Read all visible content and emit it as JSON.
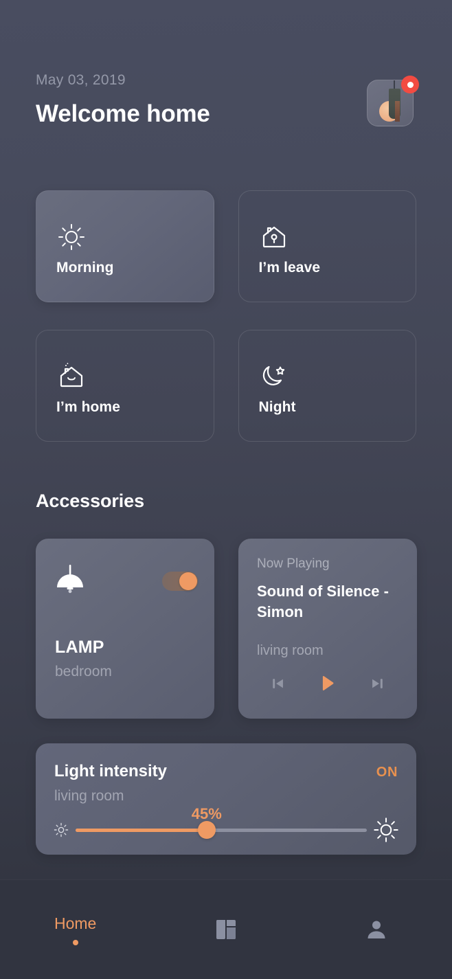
{
  "header": {
    "date": "May 03, 2019",
    "title": "Welcome home",
    "avatar_name": "user-avatar",
    "notification_badge": "notification-dot"
  },
  "scenes": [
    {
      "label": "Morning",
      "icon": "sun-icon",
      "active": true
    },
    {
      "label": "I’m leave",
      "icon": "house-lock-icon",
      "active": false
    },
    {
      "label": "I’m home",
      "icon": "house-smile-icon",
      "active": false
    },
    {
      "label": "Night",
      "icon": "moon-star-icon",
      "active": false
    }
  ],
  "accessories": {
    "section_title": "Accessories",
    "lamp": {
      "icon": "pendant-lamp-icon",
      "name": "LAMP",
      "room": "bedroom",
      "toggle_state": "on"
    },
    "media": {
      "now_playing_label": "Now Playing",
      "track": "Sound of Silence - Simon",
      "room": "living room",
      "prev_icon": "skip-previous-icon",
      "play_icon": "play-icon",
      "next_icon": "skip-next-icon"
    },
    "light_intensity": {
      "title": "Light intensity",
      "room": "living room",
      "state": "ON",
      "value_label": "45%",
      "value": 45,
      "min_icon": "sun-small-icon",
      "max_icon": "sun-large-icon"
    }
  },
  "navbar": {
    "items": [
      {
        "label": "Home",
        "icon": "home-label",
        "active": true
      },
      {
        "label": "",
        "icon": "dashboard-icon",
        "active": false
      },
      {
        "label": "",
        "icon": "profile-icon",
        "active": false
      }
    ]
  },
  "colors": {
    "accent": "#ef9a63",
    "accent_text": "#e8914f",
    "badge": "#f24b42",
    "card": "#646879",
    "background_top": "#494d60",
    "background_bottom": "#2f323d",
    "muted_text": "#a2a5b2"
  }
}
